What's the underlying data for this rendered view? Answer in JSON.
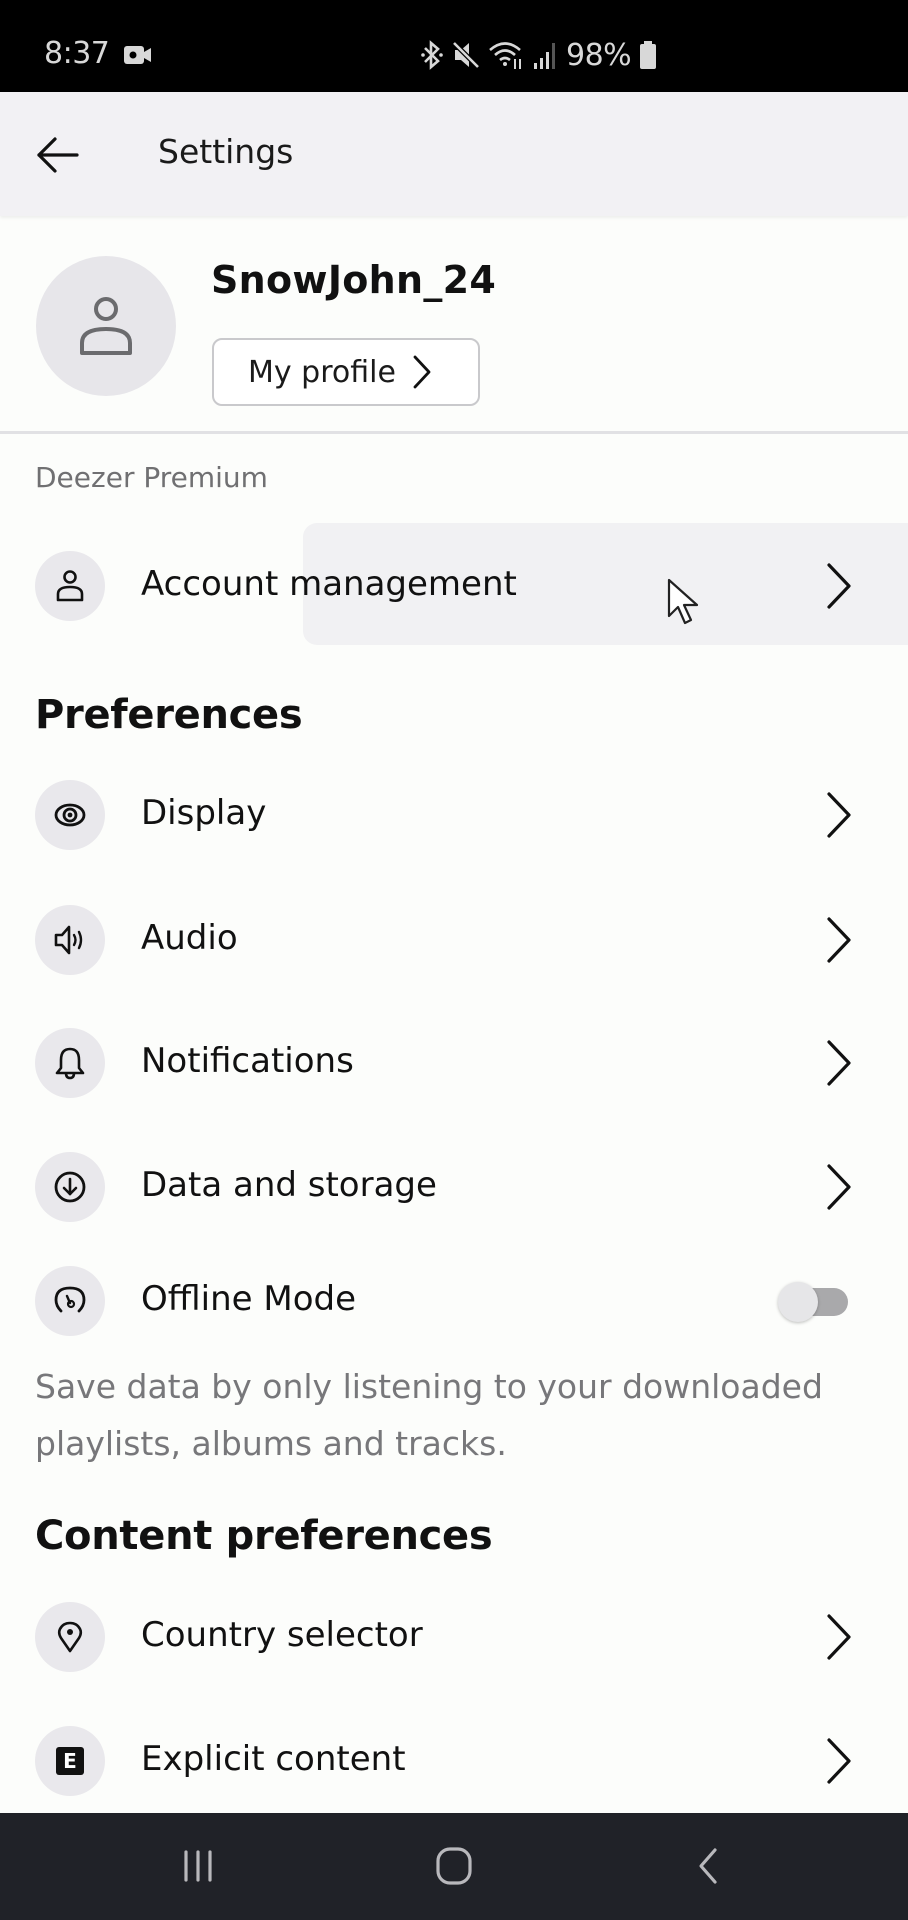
{
  "status_bar": {
    "time": "8:37",
    "battery_percent": "98%",
    "icons": [
      "video-recording-icon",
      "bluetooth-icon",
      "mute-icon",
      "wifi-icon",
      "signal-icon",
      "battery-icon"
    ]
  },
  "header": {
    "title": "Settings",
    "back_icon": "arrow-left-icon"
  },
  "profile": {
    "username": "SnowJohn_24",
    "profile_button_label": "My profile",
    "avatar_icon": "user-icon"
  },
  "sections": {
    "premium": {
      "label": "Deezer Premium",
      "items": [
        {
          "label": "Account management",
          "icon": "user-icon",
          "highlighted": true
        }
      ]
    },
    "preferences": {
      "title": "Preferences",
      "items": [
        {
          "label": "Display",
          "icon": "eye-icon"
        },
        {
          "label": "Audio",
          "icon": "speaker-icon"
        },
        {
          "label": "Notifications",
          "icon": "bell-icon"
        },
        {
          "label": "Data and storage",
          "icon": "download-icon"
        },
        {
          "label": "Offline Mode",
          "icon": "offline-gauge-icon",
          "toggle": false
        }
      ],
      "offline_description": "Save data by only listening to your downloaded playlists, albums and tracks."
    },
    "content_preferences": {
      "title": "Content preferences",
      "items": [
        {
          "label": "Country selector",
          "icon": "location-pin-icon"
        },
        {
          "label": "Explicit content",
          "icon": "explicit-icon",
          "icon_glyph": "E"
        }
      ]
    }
  },
  "nav_bar": {
    "buttons": [
      "recent-apps",
      "home",
      "back"
    ]
  },
  "colors": {
    "header_bg": "#f2f1f4",
    "page_bg": "#fcfdfb",
    "icon_circle_bg": "#e9e8ec",
    "secondary_text": "#707072",
    "nav_bar_bg": "#202228"
  }
}
